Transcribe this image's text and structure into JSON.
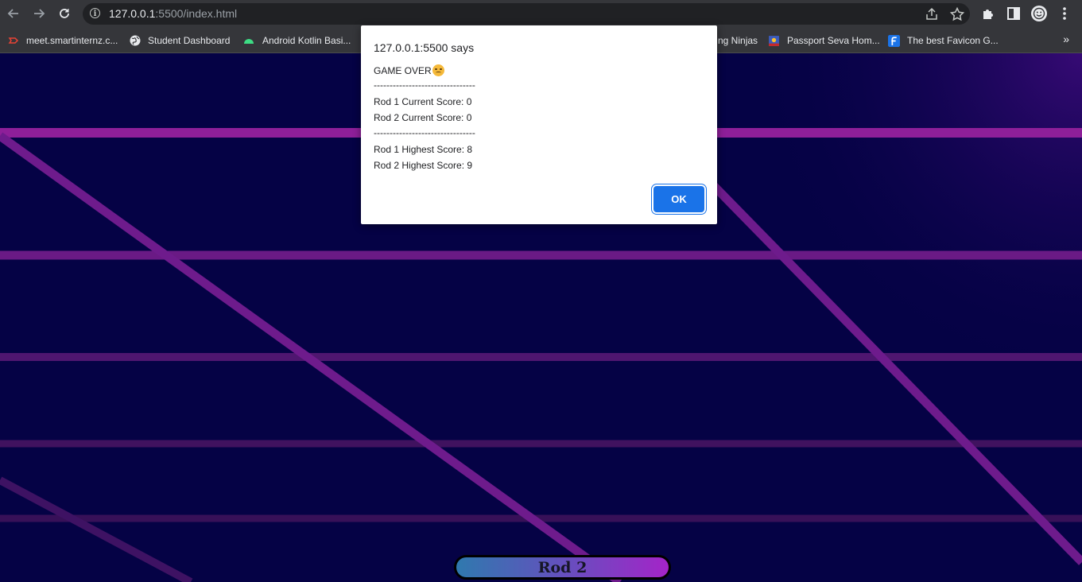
{
  "browser": {
    "url_host": "127.0.0.1",
    "url_rest": ":5500/index.html",
    "bookmarks": [
      {
        "label": "meet.smartinternz.c...",
        "icon": "meet-icon",
        "color": "#ea4335"
      },
      {
        "label": "Student Dashboard",
        "icon": "globe-icon",
        "color": "#e8eaed"
      },
      {
        "label": "Android Kotlin Basi...",
        "icon": "android-icon",
        "color": "#3ddc84"
      },
      {
        "label": "ng Ninjas",
        "icon": "",
        "color": ""
      },
      {
        "label": "Passport Seva Hom...",
        "icon": "passport-seva-icon",
        "color": "#3b5bbb"
      },
      {
        "label": "The best Favicon G...",
        "icon": "favicon-generator-icon",
        "color": "#1a73e8"
      }
    ],
    "more_label": "»"
  },
  "dialog": {
    "title": "127.0.0.1:5500 says",
    "message_head": "GAME OVER",
    "divider": "--------------------------------",
    "rod1_current": "Rod 1 Current Score: 0",
    "rod2_current": "Rod 2 Current Score: 0",
    "rod1_highest": "Rod 1 Highest Score: 8",
    "rod2_highest": "Rod 2 Highest Score: 9",
    "ok_label": "OK",
    "emoji": "disappointed-face"
  },
  "game": {
    "rod_label": "Rod 2",
    "colors": {
      "background": "#050245",
      "grid": "#7b1f96",
      "rod_start": "#2f79ae",
      "rod_end": "#a424c8"
    }
  }
}
